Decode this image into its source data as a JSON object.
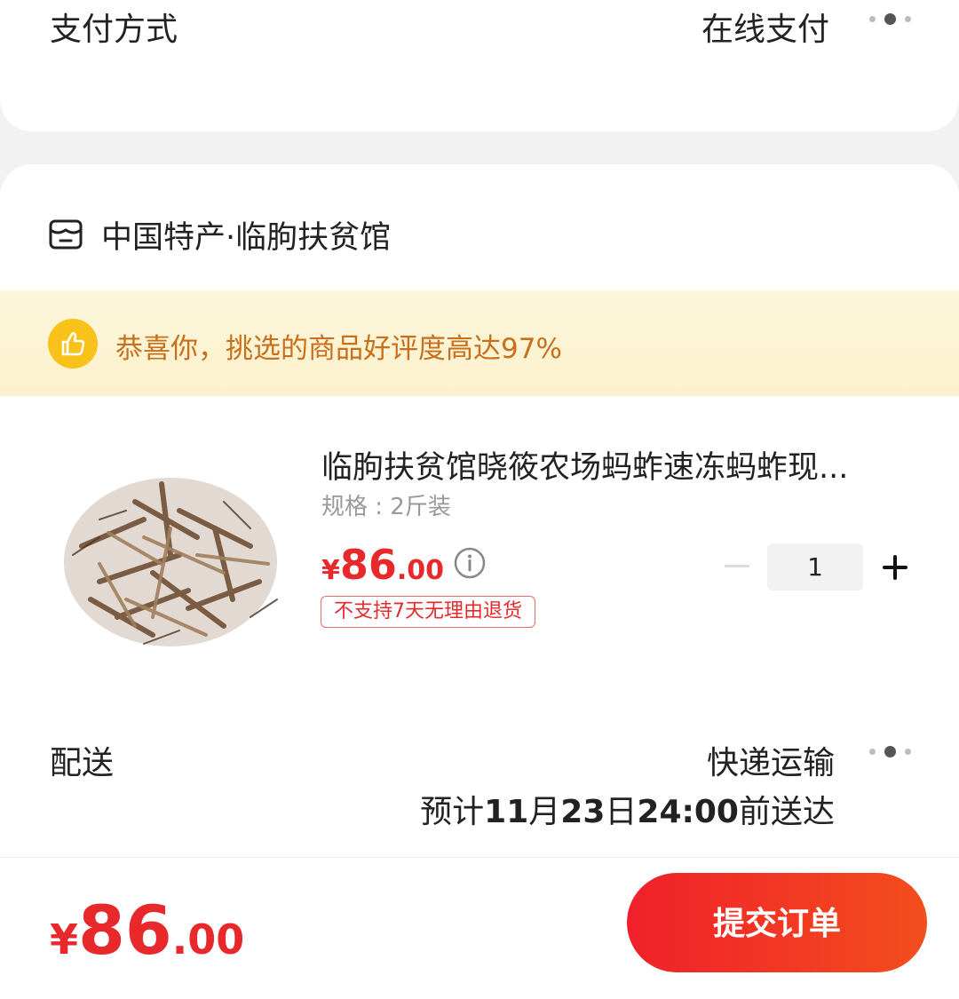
{
  "payment": {
    "label": "支付方式",
    "value": "在线支付"
  },
  "store": {
    "name": "中国特产·临朐扶贫馆"
  },
  "banner": {
    "text": "恭喜你，挑选的商品好评度高达97%"
  },
  "product": {
    "title": "临朐扶贫馆晓筱农场蚂蚱速冻蚂蚱现...",
    "spec": "规格 : 2斤装",
    "price_symbol": "¥",
    "price_int": "86",
    "price_dec": ".00",
    "return_policy": "不支持7天无理由退货",
    "quantity": "1",
    "image_icon": "dried-grasshoppers-image"
  },
  "shipping": {
    "label": "配送",
    "method": "快递运输",
    "eta_prefix": "预计",
    "eta_month": "11",
    "eta_month_unit": "月",
    "eta_day": "23",
    "eta_day_unit": "日",
    "eta_time": "24:00",
    "eta_suffix": "前送达"
  },
  "footer": {
    "total_symbol": "¥",
    "total_int": "86",
    "total_dec": ".00",
    "submit_label": "提交订单"
  },
  "colors": {
    "price_red": "#e8292c",
    "banner_text": "#c86f1c",
    "button_red": "#f0202a"
  }
}
